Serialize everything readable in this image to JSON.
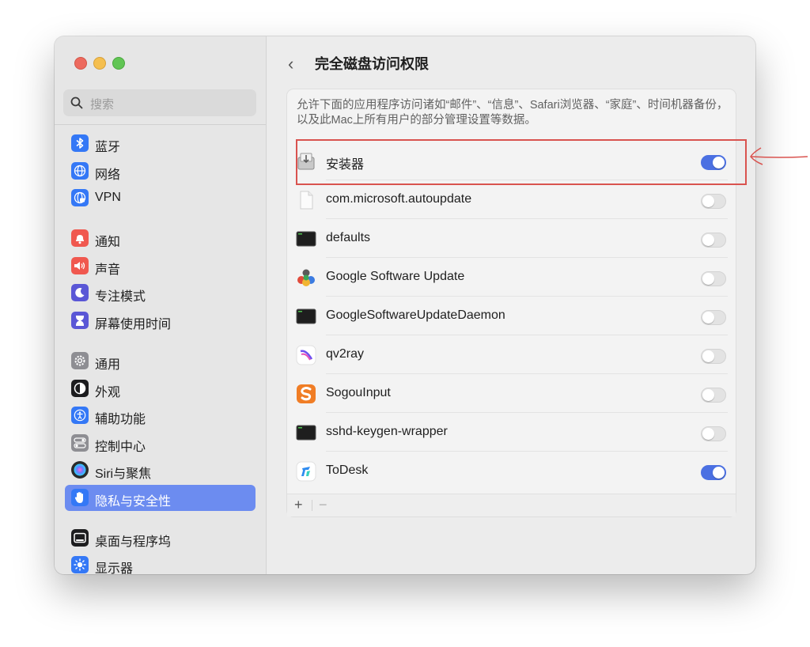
{
  "sidebar": {
    "search_placeholder": "搜索",
    "items": [
      {
        "label": "蓝牙",
        "icon": "bluetooth-icon",
        "color": "#3478f6"
      },
      {
        "label": "网络",
        "icon": "globe-icon",
        "color": "#3478f6"
      },
      {
        "label": "VPN",
        "icon": "vpn-globe-icon",
        "color": "#3478f6"
      },
      {
        "label": "通知",
        "icon": "bell-icon",
        "color": "#f0584f"
      },
      {
        "label": "声音",
        "icon": "speaker-icon",
        "color": "#f0584f"
      },
      {
        "label": "专注模式",
        "icon": "moon-icon",
        "color": "#5a57d6"
      },
      {
        "label": "屏幕使用时间",
        "icon": "hourglass-icon",
        "color": "#5a57d6"
      },
      {
        "label": "通用",
        "icon": "gear-icon",
        "color": "#8e8e93"
      },
      {
        "label": "外观",
        "icon": "appearance-icon",
        "color": "#1d1d1f"
      },
      {
        "label": "辅助功能",
        "icon": "accessibility-icon",
        "color": "#3478f6"
      },
      {
        "label": "控制中心",
        "icon": "control-center-icon",
        "color": "#8e8e93"
      },
      {
        "label": "Siri与聚焦",
        "icon": "siri-icon",
        "color": "#2a2a2a"
      },
      {
        "label": "隐私与安全性",
        "icon": "hand-icon",
        "color": "#3478f6",
        "selected": true
      },
      {
        "label": "桌面与程序坞",
        "icon": "dock-icon",
        "color": "#1d1d1f"
      },
      {
        "label": "显示器",
        "icon": "sun-icon",
        "color": "#3478f6"
      }
    ]
  },
  "header": {
    "back_label": "‹",
    "title": "完全磁盘访问权限"
  },
  "panel": {
    "description": "允许下面的应用程序访问诸如“邮件”、“信息”、Safari浏览器、“家庭”、时间机器备份，以及此Mac上所有用户的部分管理设置等数据。",
    "apps": [
      {
        "label": "安装器",
        "icon": "installer-icon",
        "enabled": true
      },
      {
        "label": "com.microsoft.autoupdate",
        "icon": "document-icon",
        "enabled": false
      },
      {
        "label": "defaults",
        "icon": "terminal-icon",
        "enabled": false
      },
      {
        "label": "Google Software Update",
        "icon": "google-update-icon",
        "enabled": false
      },
      {
        "label": "GoogleSoftwareUpdateDaemon",
        "icon": "terminal-icon",
        "enabled": false
      },
      {
        "label": "qv2ray",
        "icon": "qv2ray-icon",
        "enabled": false
      },
      {
        "label": "SogouInput",
        "icon": "sogou-icon",
        "enabled": false
      },
      {
        "label": "sshd-keygen-wrapper",
        "icon": "terminal-icon",
        "enabled": false
      },
      {
        "label": "ToDesk",
        "icon": "todesk-icon",
        "enabled": true
      }
    ],
    "add_label": "+",
    "remove_label": "−"
  },
  "annotation": {
    "color": "#d9534f"
  }
}
